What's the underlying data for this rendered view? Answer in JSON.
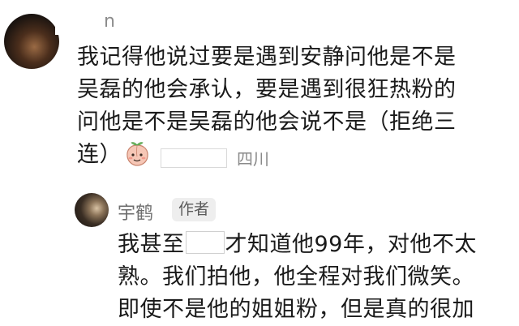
{
  "comment1": {
    "username_suffix": "n",
    "lines": [
      "我记得他说过要是遇到安静问他是不是",
      "吴磊的他会承认，要是遇到很狂热粉的",
      "问他是不是吴磊的他会说不是（拒绝三",
      "连）"
    ],
    "emoji": "peach-face-emoji",
    "location": "四川"
  },
  "reply": {
    "username": "宇鹤",
    "badge": "作者",
    "line1_before": "我甚至",
    "line1_after": "才知道他99年，对他不太",
    "line2": "熟。我们拍他，他全程对我们微笑。",
    "line3": "即使不是他的姐姐粉，但是真的很加"
  }
}
